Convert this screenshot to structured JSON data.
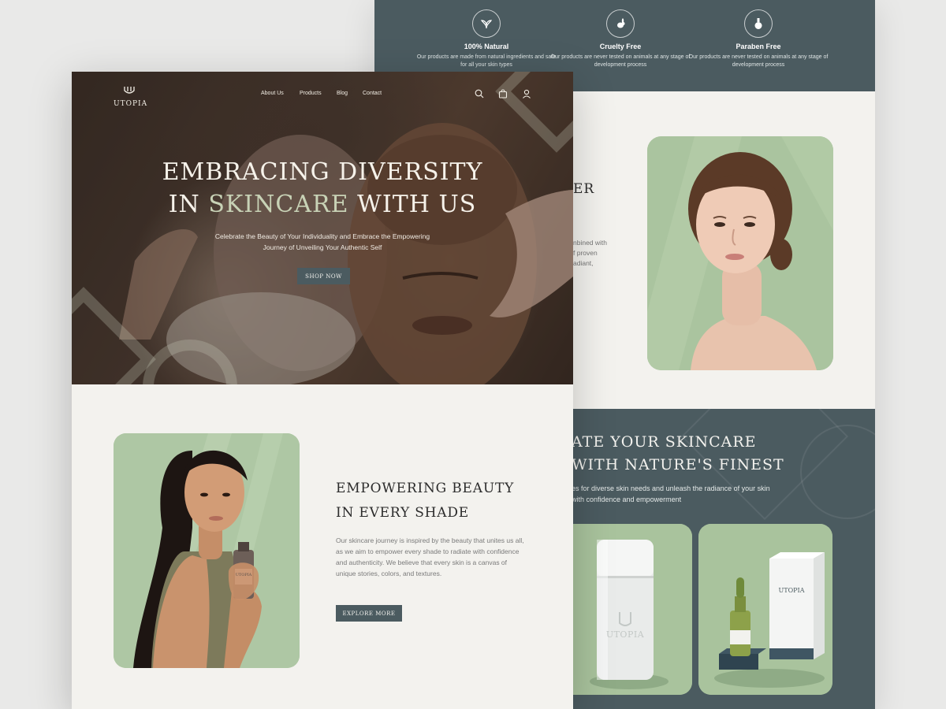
{
  "colors": {
    "slate": "#4b5b60",
    "sage": "#aec7a4",
    "cream": "#f3f2ee",
    "accent_text": "#c8d2b6"
  },
  "features": [
    {
      "icon": "leaves-icon",
      "title": "100% Natural",
      "desc": "Our products are made from natural ingredients and safe for all your skin types"
    },
    {
      "icon": "rabbit-icon",
      "title": "Cruelty Free",
      "desc": "Our products are never tested on animals at any stage of development process"
    },
    {
      "icon": "flask-icon",
      "title": "Paraben Free",
      "desc": "Our products are never tested on animals at any stage of development process"
    }
  ],
  "product_section": {
    "heading_fragment": "ER",
    "desc_fragment": "nbined with\nf proven\nadiant,"
  },
  "dark_section": {
    "heading_line1": "ATE YOUR SKINCARE",
    "heading_line2": "WITH NATURE'S FINEST",
    "desc": "es for diverse skin needs and unleash the radiance of your skin with confidence and empowerment",
    "product_label": "UTOPIA"
  },
  "nav": {
    "logo": "UTOPIA",
    "links": [
      "About Us",
      "Products",
      "Blog",
      "Contact"
    ],
    "icons": [
      "search-icon",
      "bag-icon",
      "user-icon"
    ]
  },
  "hero": {
    "title_line1": "EMBRACING DIVERSITY",
    "title_line2_prefix": "IN ",
    "title_line2_accent": "SKINCARE",
    "title_line2_suffix": " WITH US",
    "subtitle": "Celebrate the Beauty of Your Individuality and Embrace the Empowering Journey of Unveiling Your Authentic Self",
    "cta": "SHOP NOW"
  },
  "about": {
    "heading_line1": "EMPOWERING BEAUTY",
    "heading_line2": "IN EVERY SHADE",
    "desc": "Our skincare journey is inspired by the beauty that unites us all, as we aim to empower every shade to radiate with confidence and authenticity. We believe that every skin is a canvas of unique stories, colors, and textures.",
    "cta": "EXPLORE MORE",
    "bottle_label": "UTOPIA"
  }
}
